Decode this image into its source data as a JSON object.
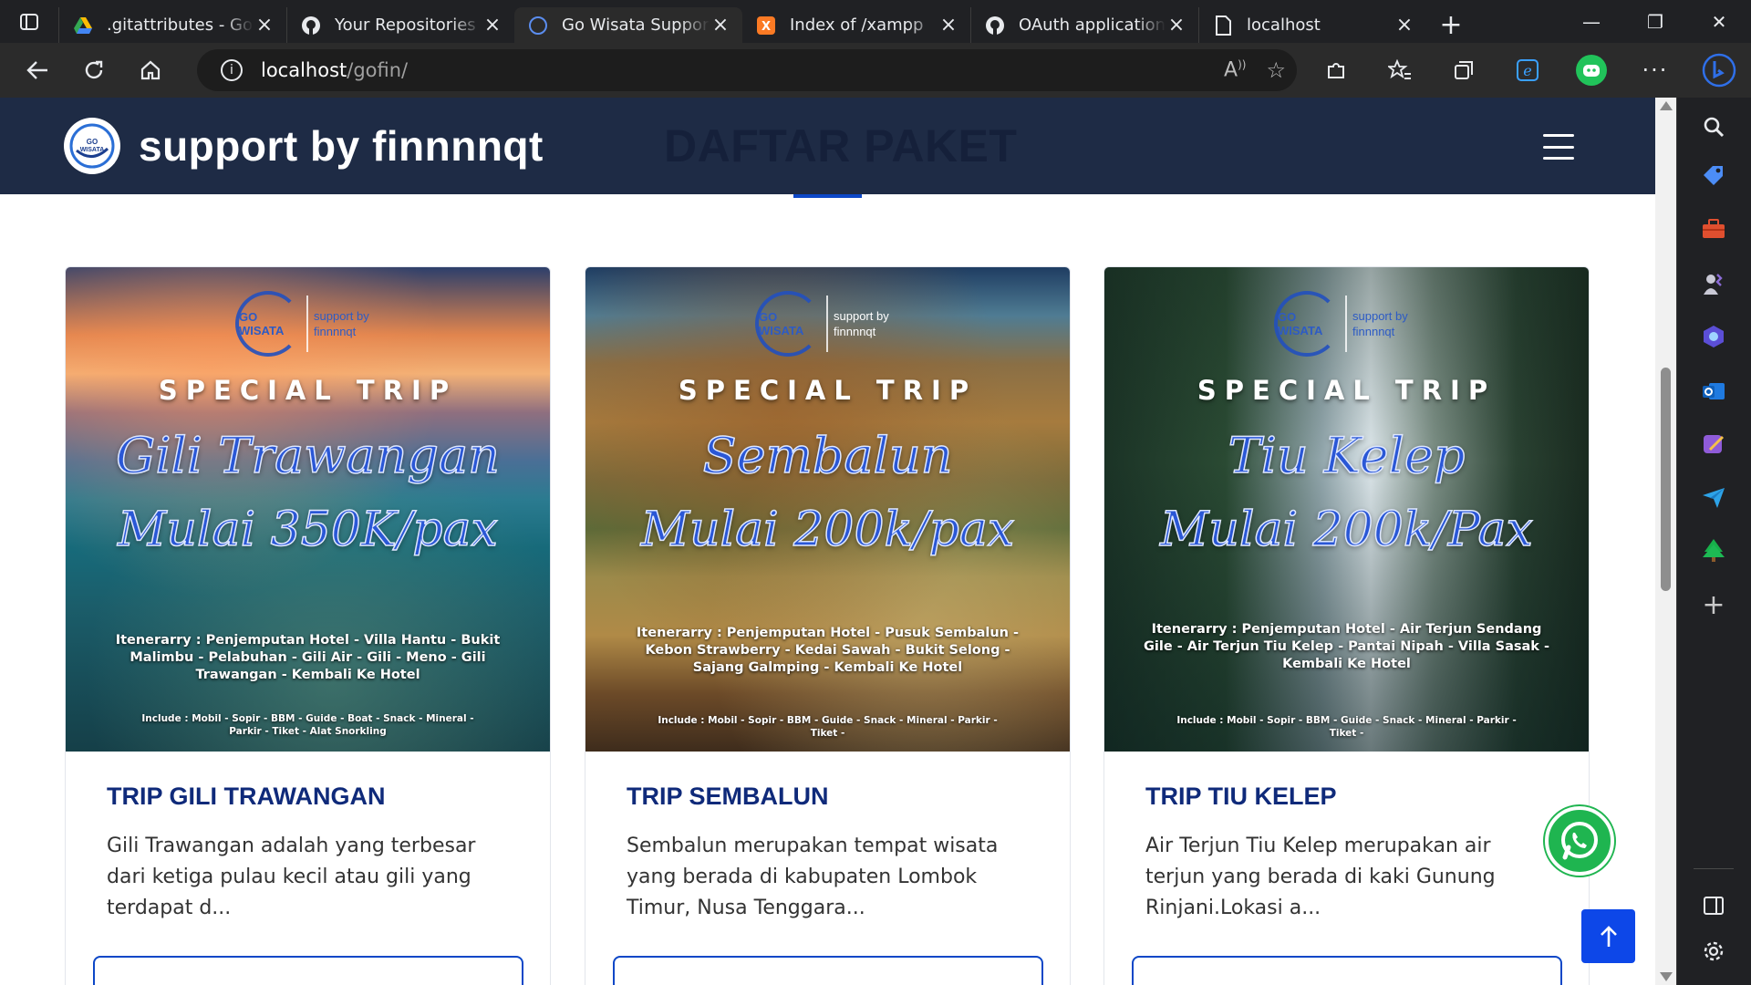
{
  "browser": {
    "tabs": [
      {
        "title": ".gitattributes - Goo",
        "icon": "google-drive-icon"
      },
      {
        "title": "Your Repositories",
        "icon": "github-icon"
      },
      {
        "title": "Go Wisata Support",
        "icon": "site-logo-icon",
        "active": true
      },
      {
        "title": "Index of /xampp",
        "icon": "xampp-icon"
      },
      {
        "title": "OAuth application",
        "icon": "github-icon"
      },
      {
        "title": "localhost",
        "icon": "page-icon"
      }
    ],
    "address": {
      "host": "localhost",
      "path": "/gofin/"
    }
  },
  "site": {
    "brand_name": "support by finnnnqt",
    "section_title": "DAFTAR PAKET",
    "colors": {
      "header": "#1e2b45",
      "accent": "#0d47c7",
      "title": "#0f2a7a"
    }
  },
  "cards": [
    {
      "title": "TRIP GILI TRAWANGAN",
      "desc": "Gili Trawangan adalah yang terbesar dari ketiga pulau kecil atau gili yang terdapat d...",
      "poster": {
        "special": "SPECIAL TRIP",
        "name": "Gili Trawangan",
        "price": "Mulai 350K/pax",
        "itinerary": "Itenerarry : Penjemputan Hotel - Villa Hantu - Bukit Malimbu - Pelabuhan - Gili Air - Gili - Meno - Gili Trawangan - Kembali Ke Hotel",
        "include": "Include : Mobil - Sopir - BBM - Guide - Boat - Snack - Mineral - Parkir - Tiket - Alat Snorkling",
        "logo_text": "GO WISATA",
        "logo_sub": "support by finnnnqt"
      }
    },
    {
      "title": "TRIP SEMBALUN",
      "desc": "Sembalun merupakan tempat wisata yang berada di kabupaten Lombok Timur, Nusa Tenggara...",
      "poster": {
        "special": "SPECIAL TRIP",
        "name": "Sembalun",
        "price": "Mulai 200k/pax",
        "itinerary": "Itenerarry : Penjemputan Hotel - Pusuk Sembalun - Kebon Strawberry - Kedai Sawah - Bukit Selong - Sajang Galmping - Kembali Ke Hotel",
        "include": "Include : Mobil - Sopir - BBM - Guide - Snack - Mineral - Parkir - Tiket -",
        "logo_text": "GO WISATA",
        "logo_sub": "support by finnnnqt"
      }
    },
    {
      "title": "TRIP TIU KELEP",
      "desc": "Air Terjun Tiu Kelep merupakan air terjun yang berada di kaki Gunung Rinjani.Lokasi a...",
      "poster": {
        "special": "SPECIAL TRIP",
        "name": "Tiu Kelep",
        "price": "Mulai 200k/Pax",
        "itinerary": "Itenerarry : Penjemputan Hotel - Air Terjun Sendang Gile - Air Terjun Tiu Kelep - Pantai Nipah - Villa Sasak - Kembali Ke Hotel",
        "include": "Include : Mobil - Sopir - BBM - Guide - Snack - Mineral - Parkir - Tiket -",
        "logo_text": "GO WISATA",
        "logo_sub": "support by finnnnqt"
      }
    }
  ]
}
